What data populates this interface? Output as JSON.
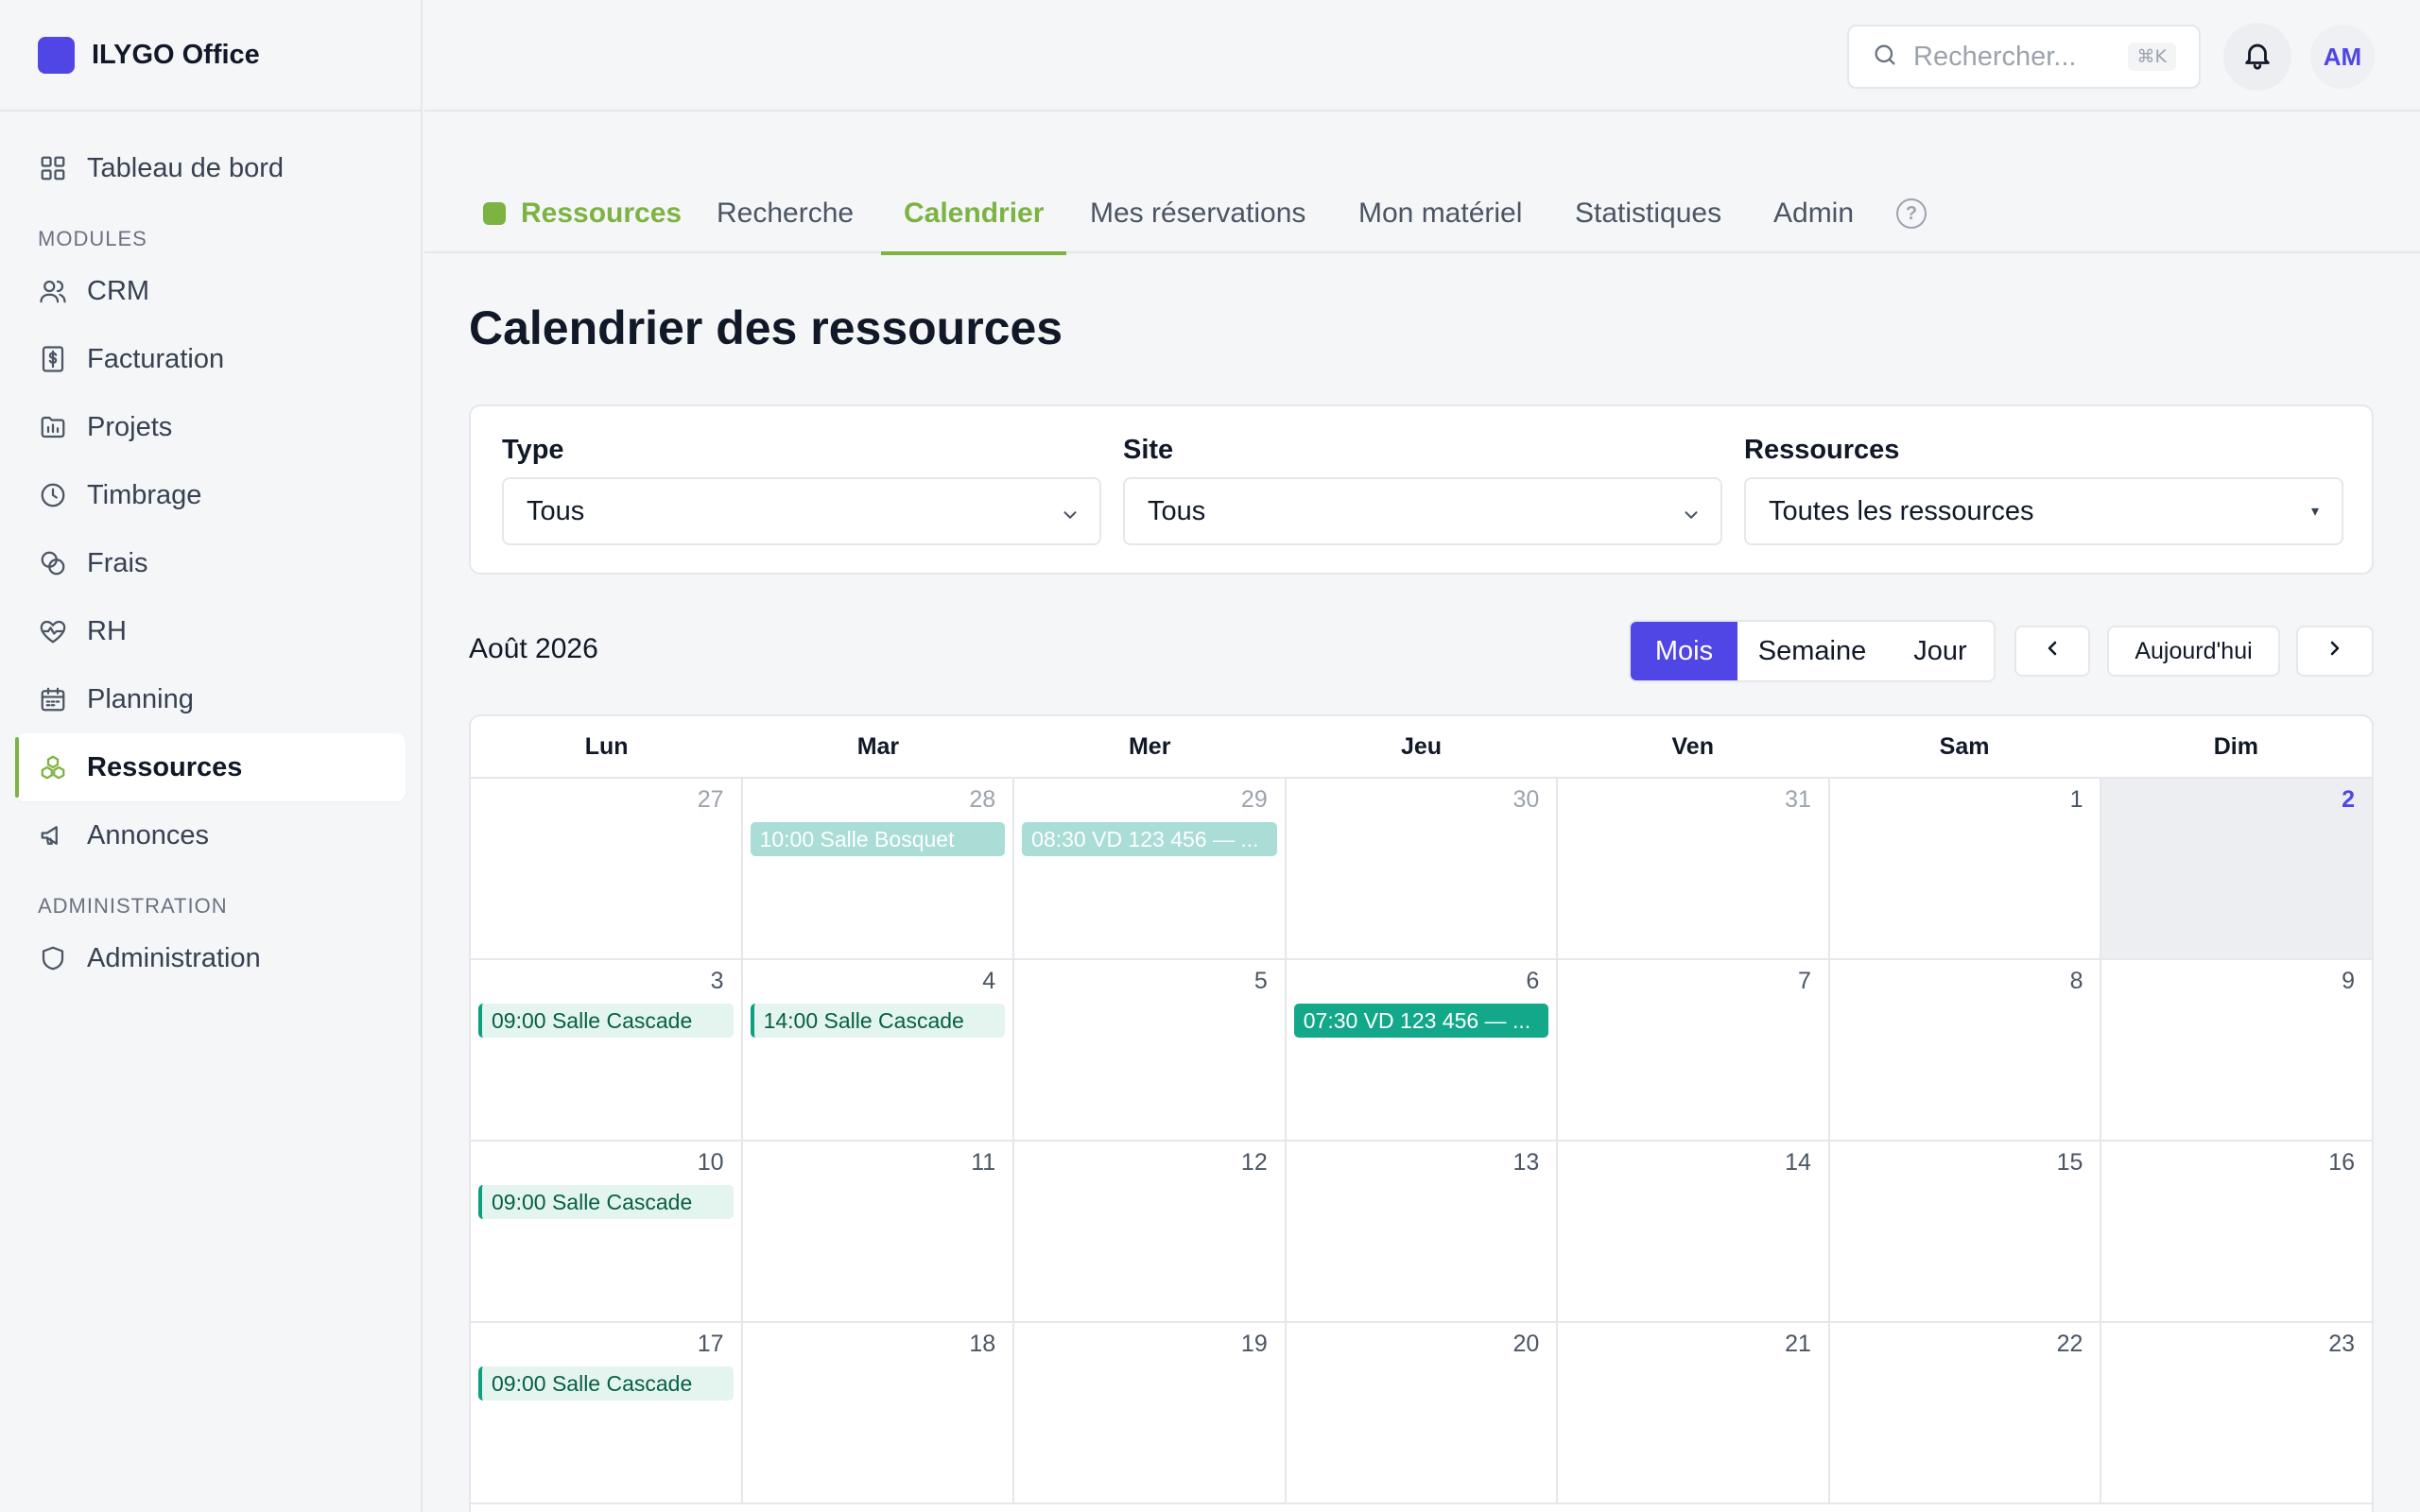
{
  "app": {
    "name": "ILYGO Office"
  },
  "sidebar": {
    "top_item": {
      "label": "Tableau de bord",
      "icon": "grid-icon"
    },
    "modules_heading": "MODULES",
    "items": [
      {
        "label": "CRM",
        "icon": "users-icon"
      },
      {
        "label": "Facturation",
        "icon": "invoice-icon"
      },
      {
        "label": "Projets",
        "icon": "folder-icon"
      },
      {
        "label": "Timbrage",
        "icon": "clock-icon"
      },
      {
        "label": "Frais",
        "icon": "coins-icon"
      },
      {
        "label": "RH",
        "icon": "heart-pulse-icon"
      },
      {
        "label": "Planning",
        "icon": "calendar-icon"
      },
      {
        "label": "Ressources",
        "icon": "boxes-icon"
      },
      {
        "label": "Annonces",
        "icon": "megaphone-icon"
      }
    ],
    "admin_heading": "ADMINISTRATION",
    "admin_item": {
      "label": "Administration",
      "icon": "shield-icon"
    }
  },
  "topbar": {
    "search_placeholder": "Rechercher...",
    "search_shortcut": "⌘K",
    "avatar_initials": "AM"
  },
  "tabs": {
    "brand": "Ressources",
    "items": [
      "Recherche",
      "Calendrier",
      "Mes réservations",
      "Mon matériel",
      "Statistiques",
      "Admin"
    ],
    "active": "Calendrier",
    "help": "?"
  },
  "page": {
    "title": "Calendrier des ressources"
  },
  "filters": {
    "type": {
      "label": "Type",
      "value": "Tous"
    },
    "site": {
      "label": "Site",
      "value": "Tous"
    },
    "resources": {
      "label": "Ressources",
      "value": "Toutes les ressources"
    }
  },
  "calendar": {
    "month_label": "Août 2026",
    "views": [
      "Mois",
      "Semaine",
      "Jour"
    ],
    "active_view": "Mois",
    "today_label": "Aujourd'hui",
    "weekdays": [
      "Lun",
      "Mar",
      "Mer",
      "Jeu",
      "Ven",
      "Sam",
      "Dim"
    ],
    "weeks": [
      [
        {
          "day": "27",
          "other": true
        },
        {
          "day": "28",
          "other": true,
          "event": {
            "text": "10:00 Salle Bosquet",
            "style": "faded"
          }
        },
        {
          "day": "29",
          "other": true,
          "event": {
            "text": "08:30 VD 123 456 — ...",
            "style": "faded"
          }
        },
        {
          "day": "30",
          "other": true
        },
        {
          "day": "31",
          "other": true
        },
        {
          "day": "1"
        },
        {
          "day": "2",
          "today": true
        }
      ],
      [
        {
          "day": "3",
          "event": {
            "text": "09:00 Salle Cascade",
            "style": "light"
          }
        },
        {
          "day": "4",
          "event": {
            "text": "14:00 Salle Cascade",
            "style": "light"
          }
        },
        {
          "day": "5"
        },
        {
          "day": "6",
          "event": {
            "text": "07:30 VD 123 456 — ...",
            "style": "solid"
          }
        },
        {
          "day": "7"
        },
        {
          "day": "8"
        },
        {
          "day": "9"
        }
      ],
      [
        {
          "day": "10",
          "event": {
            "text": "09:00 Salle Cascade",
            "style": "light"
          }
        },
        {
          "day": "11"
        },
        {
          "day": "12"
        },
        {
          "day": "13"
        },
        {
          "day": "14"
        },
        {
          "day": "15"
        },
        {
          "day": "16"
        }
      ],
      [
        {
          "day": "17",
          "event": {
            "text": "09:00 Salle Cascade",
            "style": "light"
          }
        },
        {
          "day": "18"
        },
        {
          "day": "19"
        },
        {
          "day": "20"
        },
        {
          "day": "21"
        },
        {
          "day": "22"
        },
        {
          "day": "23"
        }
      ]
    ]
  },
  "colors": {
    "accent": "#4f46e5",
    "brand_green": "#7cb342",
    "event_teal": "#12a889"
  }
}
